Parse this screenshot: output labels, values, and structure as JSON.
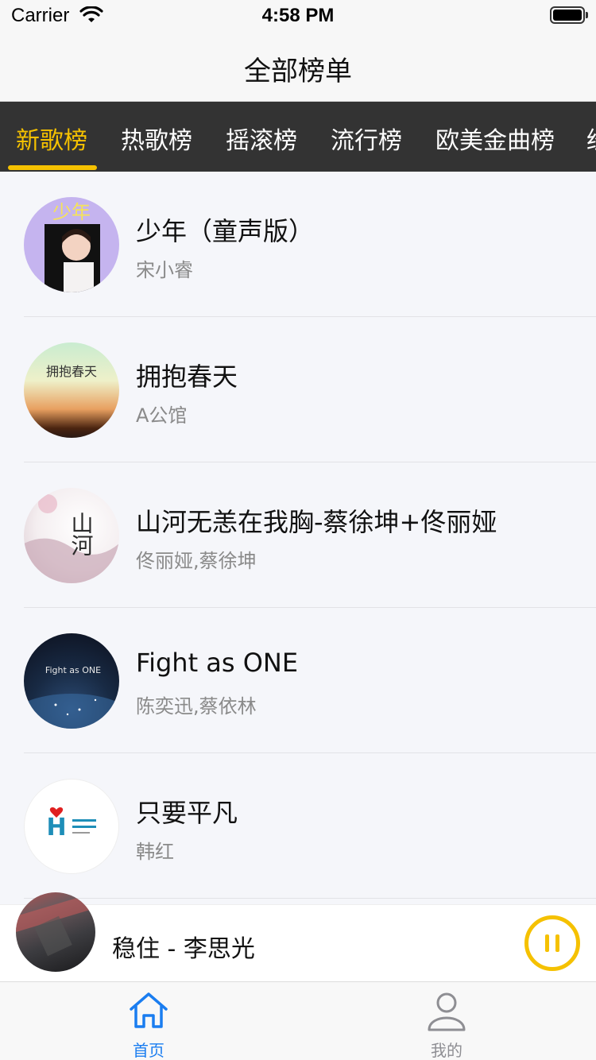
{
  "status_bar": {
    "carrier": "Carrier",
    "time": "4:58 PM"
  },
  "nav": {
    "title": "全部榜单"
  },
  "tabs": [
    {
      "label": "新歌榜",
      "active": true
    },
    {
      "label": "热歌榜",
      "active": false
    },
    {
      "label": "摇滚榜",
      "active": false
    },
    {
      "label": "流行榜",
      "active": false
    },
    {
      "label": "欧美金曲榜",
      "active": false
    },
    {
      "label": "经",
      "active": false
    }
  ],
  "songs": [
    {
      "title": "少年（童声版）",
      "artist": "宋小睿",
      "cover_text": "少年"
    },
    {
      "title": "拥抱春天",
      "artist": "A公馆",
      "cover_text": "拥抱春天"
    },
    {
      "title": "山河无恙在我胸-蔡徐坤+佟丽娅",
      "artist": "佟丽娅,蔡徐坤",
      "cover_text": "山河"
    },
    {
      "title": "Fight as ONE",
      "artist": "陈奕迅,蔡依林",
      "cover_text": "Fight as ONE"
    },
    {
      "title": "只要平凡",
      "artist": "韩红",
      "cover_text": "H"
    }
  ],
  "player": {
    "now_playing": "稳住 - 李思光"
  },
  "tab_bar": {
    "home_label": "首页",
    "mine_label": "我的"
  },
  "colors": {
    "accent": "#f5c100",
    "tab_bg": "#333333",
    "active_tab": "#1a7df0"
  }
}
